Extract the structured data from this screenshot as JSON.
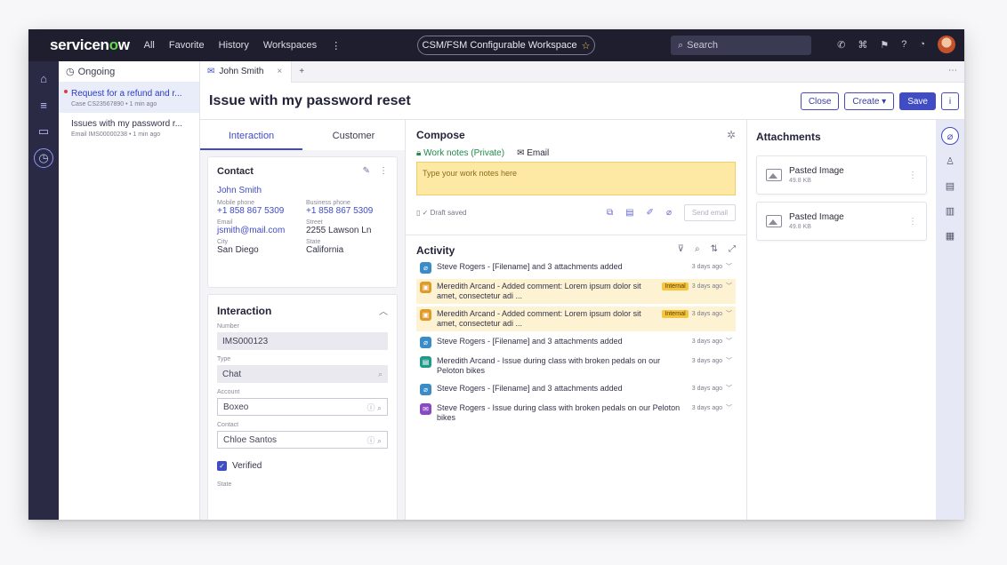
{
  "topbar": {
    "brand_prefix": "servicen",
    "brand_o": "o",
    "brand_suffix": "w",
    "nav": [
      "All",
      "Favorite",
      "History",
      "Workspaces"
    ],
    "nav_more": "⋮",
    "workspace": "CSM/FSM Configurable Workspace",
    "search_placeholder": "Search"
  },
  "conversations": {
    "header": "Ongoing",
    "items": [
      {
        "title": "Request for a refund and r...",
        "meta": "Case  CS23567890  •  1 min ago"
      },
      {
        "title": "Issues with my password r...",
        "meta": "Email  IMS00000238  •  1 min ago"
      }
    ]
  },
  "tabs": {
    "active_tab": "John Smith",
    "close": "×",
    "add": "+",
    "more": "⋯"
  },
  "record": {
    "title": "Issue with my password reset",
    "actions": {
      "close": "Close",
      "create": "Create ▾",
      "save": "Save",
      "info": "i"
    }
  },
  "left_pane": {
    "tabs": [
      "Interaction",
      "Customer"
    ],
    "contact": {
      "header": "Contact",
      "name": "John Smith",
      "fields": [
        {
          "label": "Mobile phone",
          "value": "+1 858 867 5309",
          "link": true
        },
        {
          "label": "Business phone",
          "value": "+1 858 867 5309",
          "link": true
        },
        {
          "label": "Email",
          "value": "jsmith@mail.com",
          "link": true
        },
        {
          "label": "Street",
          "value": "2255 Lawson Ln",
          "link": false
        },
        {
          "label": "City",
          "value": "San Diego",
          "link": false
        },
        {
          "label": "State",
          "value": "California",
          "link": false
        }
      ]
    },
    "interaction": {
      "header": "Interaction",
      "fields": [
        {
          "label": "Number",
          "value": "IMS000123"
        },
        {
          "label": "Type",
          "value": "Chat"
        },
        {
          "label": "Account",
          "value": "Boxeo"
        },
        {
          "label": "Contact",
          "value": "Chloe Santos"
        }
      ],
      "verified": "Verified",
      "state_label": "State"
    }
  },
  "compose": {
    "title": "Compose",
    "tab_private": "Work notes (Private)",
    "tab_email": "Email",
    "placeholder": "Type your work notes here",
    "draft": "Draft saved",
    "send": "Send email"
  },
  "activity": {
    "title": "Activity",
    "items": [
      {
        "icon": "attachment",
        "text": "Steve Rogers - [Filename] and 3 attachments added",
        "time": "3 days ago",
        "internal": false
      },
      {
        "icon": "lock",
        "text": "Meredith Arcand - Added comment: Lorem ipsum dolor sit amet, consectetur adi ...",
        "time": "3 days ago",
        "internal": true
      },
      {
        "icon": "lock",
        "text": "Meredith Arcand - Added comment: Lorem ipsum dolor sit amet, consectetur adi ...",
        "time": "3 days ago",
        "internal": true
      },
      {
        "icon": "attachment",
        "text": "Steve Rogers - [Filename] and 3 attachments added",
        "time": "3 days ago",
        "internal": false
      },
      {
        "icon": "chat",
        "text": "Meredith Arcand - Issue during class with broken pedals on our Peloton bikes",
        "time": "3 days ago",
        "internal": false
      },
      {
        "icon": "attachment",
        "text": "Steve Rogers - [Filename] and 3 attachments added",
        "time": "3 days ago",
        "internal": false
      },
      {
        "icon": "mail",
        "text": "Steve Rogers - Issue during class with broken pedals on our Peloton bikes",
        "time": "3 days ago",
        "internal": false
      }
    ],
    "internal_label": "Internal"
  },
  "attachments": {
    "title": "Attachments",
    "items": [
      {
        "name": "Pasted Image",
        "size": "49.8 KB"
      },
      {
        "name": "Pasted Image",
        "size": "49.8 KB"
      }
    ]
  },
  "colors": {
    "topbar": "#1e1e2f",
    "accent": "#3f4cc4",
    "work_notes": "#fde9a4",
    "internal_row": "#fdf2d2"
  }
}
